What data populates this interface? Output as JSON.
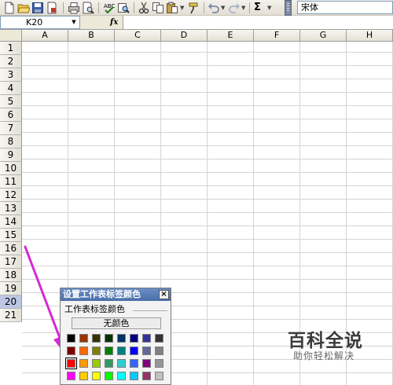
{
  "toolbar": {
    "buttons": [
      "new-icon",
      "open-icon",
      "save-icon",
      "permission-icon",
      "print-icon",
      "print-preview-icon",
      "spelling-icon",
      "research-icon",
      "cut-icon",
      "copy-icon",
      "paste-icon",
      "format-painter-icon",
      "undo-icon",
      "redo-icon"
    ],
    "sigma": "Σ",
    "font_name": "宋体"
  },
  "formula_bar": {
    "name_box": "K20",
    "fx": "fx",
    "formula": ""
  },
  "columns": [
    "A",
    "B",
    "C",
    "D",
    "E",
    "F",
    "G",
    "H"
  ],
  "rows": [
    "1",
    "2",
    "3",
    "4",
    "5",
    "6",
    "7",
    "8",
    "9",
    "10",
    "11",
    "12",
    "13",
    "14",
    "15",
    "16",
    "17",
    "18",
    "19",
    "20",
    "21"
  ],
  "active_row": "20",
  "dialog": {
    "title": "设置工作表标签颜色",
    "close": "×",
    "group_label": "工作表标签颜色",
    "no_color_label": "无颜色",
    "swatch_rows": [
      [
        "#000000",
        "#993300",
        "#333300",
        "#003300",
        "#003366",
        "#000080",
        "#333399",
        "#333333"
      ],
      [
        "#800000",
        "#ff6600",
        "#808000",
        "#008000",
        "#008080",
        "#0000ff",
        "#666699",
        "#808080"
      ],
      [
        "#ff0000",
        "#ff9900",
        "#99cc00",
        "#339966",
        "#33cccc",
        "#3366ff",
        "#800080",
        "#969696"
      ],
      [
        "#ff00ff",
        "#ffcc00",
        "#ffff00",
        "#00ff00",
        "#00ffff",
        "#00ccff",
        "#993366",
        "#c0c0c0"
      ],
      [
        "#ff99cc",
        "#ffcc99",
        "#ffff99",
        "#ccffcc",
        "#ccffff",
        "#99ccff",
        "#cc99ff",
        "#ffffff"
      ]
    ],
    "selected_swatch": "#ff0000"
  },
  "annotation_arrow_color": "#d42ad4",
  "watermark": {
    "title": "百科全说",
    "subtitle": "助你轻松解决"
  }
}
